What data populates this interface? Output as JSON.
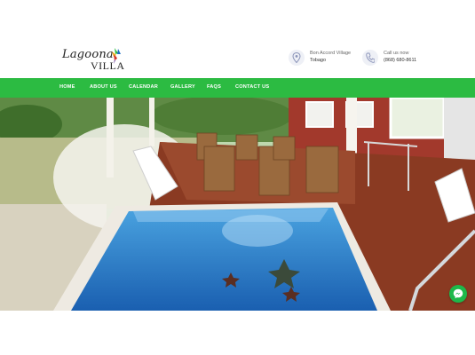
{
  "brand": {
    "logo_script": "Lagoona",
    "logo_word": "VILLA"
  },
  "header": {
    "location": {
      "line1": "Bon Accord Village",
      "line2": "Tobago",
      "icon": "location-pin-icon"
    },
    "phone": {
      "line1": "Call us now",
      "line2": "(868) 680-8611",
      "icon": "phone-icon"
    }
  },
  "nav": {
    "items": [
      {
        "label": "HOME"
      },
      {
        "label": "ABOUT US"
      },
      {
        "label": "CALENDAR"
      },
      {
        "label": "GALLERY"
      },
      {
        "label": "FAQS"
      },
      {
        "label": "CONTACT US"
      }
    ]
  },
  "hero": {
    "image": "photo of pool deck with adirondack chairs and a small plunge pool"
  },
  "colors": {
    "accent_green": "#2cbb42",
    "pool_blue": "#1f6fc4",
    "brick": "#a2392c"
  },
  "widgets": {
    "messenger": "messenger-chat-icon"
  }
}
